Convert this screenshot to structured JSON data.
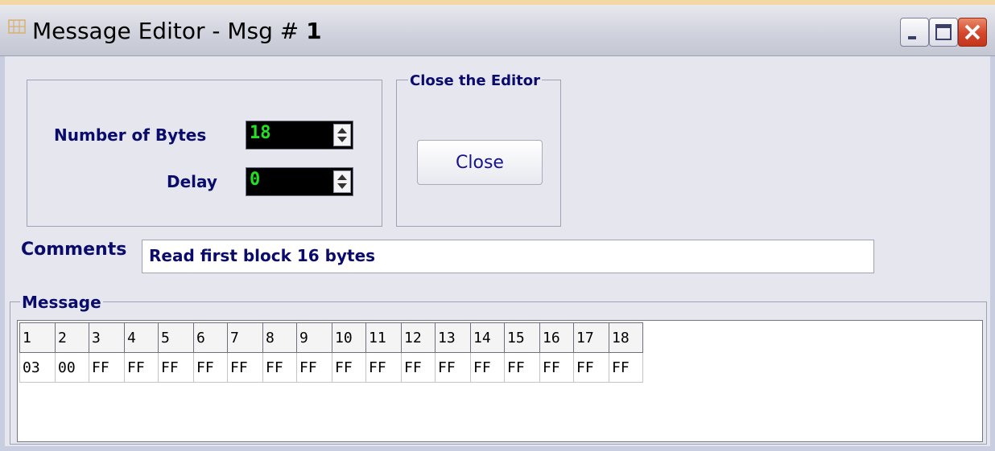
{
  "window": {
    "title_prefix": "Message Editor - Msg # ",
    "title_number": "1",
    "title_icon": "grid-app-icon",
    "controls": [
      "minimize-icon",
      "maximize-icon",
      "close-icon"
    ]
  },
  "settings": {
    "bytes_label": "Number of Bytes",
    "bytes_value": "18",
    "delay_label": "Delay",
    "delay_value": "0"
  },
  "close_group": {
    "legend": "Close the Editor",
    "button_label": "Close"
  },
  "comments": {
    "label": "Comments",
    "value": "Read first block 16 bytes"
  },
  "message": {
    "legend": "Message",
    "headers": [
      "1",
      "2",
      "3",
      "4",
      "5",
      "6",
      "7",
      "8",
      "9",
      "10",
      "11",
      "12",
      "13",
      "14",
      "15",
      "16",
      "17",
      "18"
    ],
    "values": [
      "03",
      "00",
      "FF",
      "FF",
      "FF",
      "FF",
      "FF",
      "FF",
      "FF",
      "FF",
      "FF",
      "FF",
      "FF",
      "FF",
      "FF",
      "FF",
      "FF",
      "FF"
    ]
  },
  "colors": {
    "label_text": "#0b0b6b",
    "spin_value": "#22e022",
    "close_button_text": "#141491",
    "window_close_button": "#d3462a"
  }
}
